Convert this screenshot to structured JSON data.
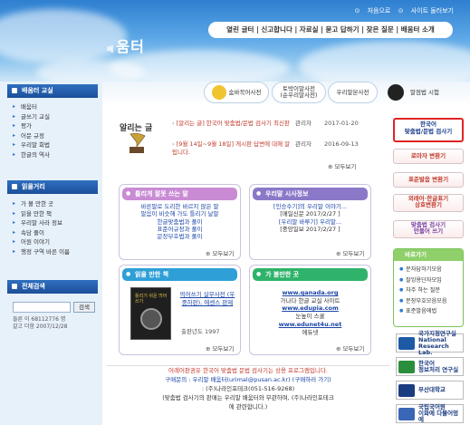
{
  "header": {
    "logo_small": "배",
    "logo": "움터",
    "top_links": [
      "처음으로",
      "사이트 둘러보기"
    ],
    "gnb": "열린 글터 | 신고합니다 | 자료실 | 묻고 답하기 | 잦은 질문 | 배움터 소개"
  },
  "dictionaries": [
    {
      "label": "숨바꼭어사전",
      "color": "#f0c330"
    },
    {
      "label": "토박이말사전\n(순우리말사전)",
      "color": "#e7b42c"
    },
    {
      "label": "우리말본사전",
      "color": "#d9a526"
    },
    {
      "label": "말점법 시험",
      "color": "#222222"
    }
  ],
  "left": {
    "sections": [
      {
        "title": "배움터 교실",
        "items": [
          "배움터",
          "글쓰기 교실",
          "평가",
          "어문 규정",
          "우리말 회법",
          "한글의 역사"
        ]
      },
      {
        "title": "읽을거리",
        "items": [
          "가 볼 만한 곳",
          "읽을 만한 책",
          "우리말 사라 정보",
          "속담 풀이",
          "어원 이야기",
          "행정 구역 바른 이름"
        ]
      },
      {
        "title": "전체검색",
        "items": []
      }
    ],
    "search_button": "검색",
    "visits": [
      "들른 이 68112776 명",
      "갈고 더함 2007/12/28"
    ]
  },
  "notices": {
    "title": "알리는 글",
    "items": [
      {
        "title": "[알리는 글] 한국어 맞춤법/문법 검사기 최신판",
        "author": "관리자",
        "date": "2017-01-20"
      },
      {
        "title": "[9월 14일~9월 18일] 게시판 답변에 대해 알립니다.",
        "author": "관리자",
        "date": "2016-09-13"
      }
    ],
    "more": "모두보기"
  },
  "boxes": [
    {
      "title": "틀리게 잘못 쓰는 말",
      "color": "#c98bd4",
      "lines": [
        "바른말로 도리한 바르지 않은 말",
        "말음이 비슷해 가도 틀리기 날말",
        "한글맞춤법과 풀이",
        "표준어규정과 풀이",
        "문장부호법과 풀이"
      ],
      "more": "모두보기"
    },
    {
      "title": "우리말 시사정보",
      "color": "#8b78c8",
      "lines": [
        "[인승수기]의 우리말 이야기...",
        "[매일신문 2017/2/27 ]",
        "[우리말 바루기] 우리말...",
        "[중앙일보 2017/2/27 ]"
      ],
      "more": "모두보기"
    },
    {
      "title": "읽을 만한 책",
      "color": "#2f9fd8",
      "book_title": "띄어쓰기 살무사전 (우중하판), 에센스 판제",
      "book_cover": "틀리기 쉬운 띄어쓰기",
      "book_meta": "출판년도 1997",
      "more": "모두보기"
    },
    {
      "title": "가 볼만한 곳",
      "color": "#2fb36b",
      "lines": [
        "www.qanada.org",
        "가나다 한글 교실 사이트",
        "www.edupia.com",
        "눈높이 스쿨",
        "www.edunet4u.net",
        "에듀넷"
      ],
      "more": "모두보기"
    }
  ],
  "right": {
    "buttons": [
      "한국어\n맞춤법/문법 검사기",
      "로마자 변환기",
      "표준발음 변환기",
      "외래어·한글표기\n상호변환기",
      "맞춤법 검사기\n만들어 쓰기"
    ],
    "related": {
      "title": "바로가기",
      "items": [
        "문자답하기모음",
        "잘잉용단자모임",
        "자주 하는 질문",
        "문장부호모음모음",
        "표준발음에법"
      ]
    },
    "banners": [
      {
        "label": "국가지정연구실\nNational Research Lab.",
        "color": "#1c5aa6"
      },
      {
        "label": "한국어\n정보처리 연구실",
        "color": "#2a8f3c"
      },
      {
        "label": "부산대학교",
        "color": "#1b3c80"
      },
      {
        "label": "국립국어원\n이화에 다물어멍에",
        "color": "#3a67b5"
      }
    ]
  },
  "footer": {
    "line1": "어례어판권유 한국어 맞춤법 문법 검사기는 상용 프로그램입니다.",
    "line2": "구매문의 : 우리말 배움터(urimal@pusan.ac.kr) (구매하러 가기)",
    "line3": ": (주)나라인포테크(051-516-9268)",
    "line4": "(맞춤법 검사기의 판매는 우리말 배움터와 무관하며, (주)나라인포테크",
    "line5": "에 관련합니다.)"
  }
}
